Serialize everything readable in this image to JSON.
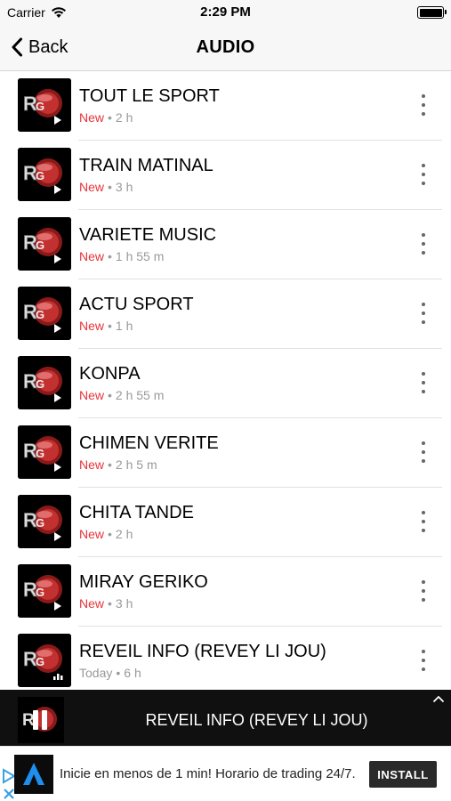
{
  "status_bar": {
    "carrier": "Carrier",
    "time": "2:29 PM"
  },
  "nav": {
    "back_label": "Back",
    "title": "AUDIO"
  },
  "colors": {
    "new_badge": "#e8343c",
    "meta_gray": "#999999",
    "player_bg": "#101010"
  },
  "items": [
    {
      "title": "TOUT LE SPORT",
      "badge": "New",
      "duration": "2 h"
    },
    {
      "title": "TRAIN MATINAL",
      "badge": "New",
      "duration": "3 h"
    },
    {
      "title": "VARIETE MUSIC",
      "badge": "New",
      "duration": "1 h 55 m"
    },
    {
      "title": "ACTU SPORT",
      "badge": "New",
      "duration": "1 h"
    },
    {
      "title": "KONPA",
      "badge": "New",
      "duration": "2 h 55 m"
    },
    {
      "title": "CHIMEN VERITE",
      "badge": "New",
      "duration": "2 h 5 m"
    },
    {
      "title": "CHITA TANDE",
      "badge": "New",
      "duration": "2 h"
    },
    {
      "title": "MIRAY GERIKO",
      "badge": "New",
      "duration": "3 h"
    },
    {
      "title": "REVEIL INFO (REVEY LI JOU)",
      "badge": "Today",
      "duration": "6 h"
    }
  ],
  "player": {
    "now_playing": "REVEIL INFO (REVEY LI JOU)",
    "state_icon": "pause-icon"
  },
  "ad": {
    "text": "Inicie en menos de 1 min! Horario de trading 24/7.",
    "cta": "INSTALL"
  }
}
